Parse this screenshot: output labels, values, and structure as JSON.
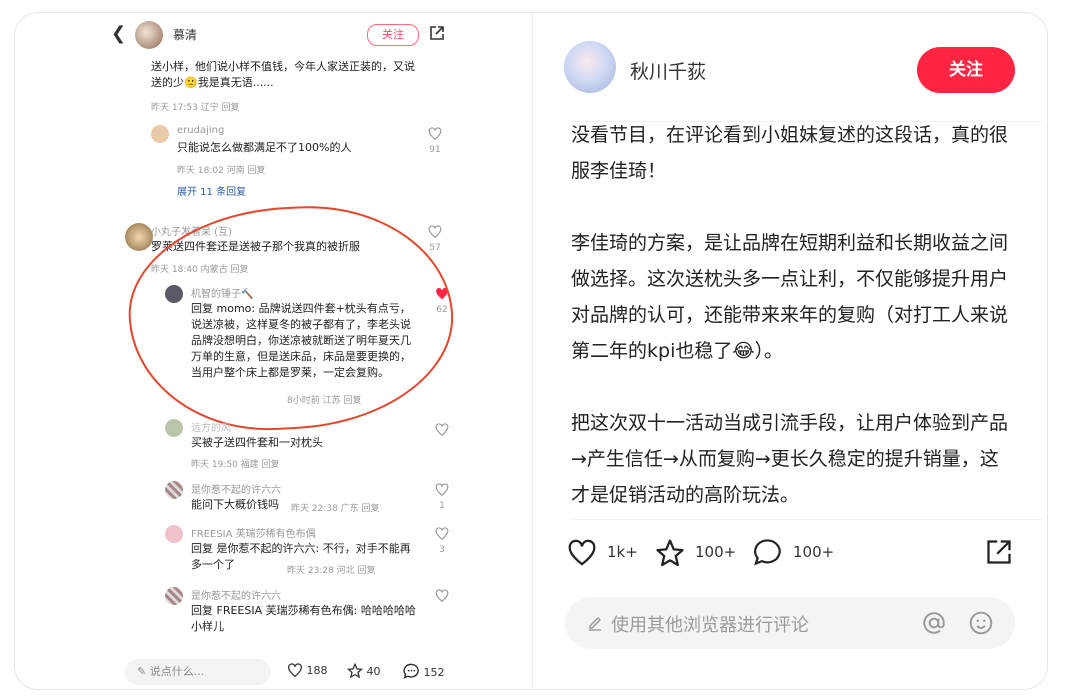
{
  "left_phone": {
    "header": {
      "back_icon": "chevron-left-icon",
      "name": "慕清",
      "follow": "关注",
      "share_icon": "share-icon"
    },
    "comments": [
      {
        "text": "送小样，他们说小样不值钱，今年人家送正装的，又说送的少🙁我是真无语......",
        "meta": "昨天 17:53 辽宁 回复"
      },
      {
        "user": "erudajing",
        "text": "只能说怎么做都满足不了100%的人",
        "meta": "昨天 18:02 河南 回复",
        "likes": "91"
      },
      {
        "expand": "展开 11 条回复"
      },
      {
        "user": "小丸子发着呆 (互)",
        "text": "罗莱送四件套还是送被子那个我真的被折服",
        "meta": "昨天 18:40 内蒙古 回复",
        "likes": "57"
      },
      {
        "user": "机智的锤子🔨",
        "text": "回复 momo: 品牌说送四件套+枕头有点亏，说送凉被，这样夏冬的被子都有了，李老头说品牌没想明白，你送凉被就断送了明年夏天几万单的生意，但是送床品，床品是要更换的，当用户整个床上都是罗莱，一定会复购。",
        "meta": "8小时前 江苏 回复",
        "likes": "62"
      },
      {
        "user": "远方的风",
        "text": "买被子送四件套和一对枕头",
        "meta": "昨天 19:50 福建 回复"
      },
      {
        "user": "是你惹不起的许六六",
        "text": "能问下大概价钱吗",
        "meta": "昨天 22:38 广东 回复",
        "likes": "1"
      },
      {
        "user": "FREESIA 芙瑞莎稀有色布偶",
        "text": "回复 是你惹不起的许六六: 不行，对手不能再多一个了",
        "meta": "昨天 23:28 河北 回复",
        "likes": "3"
      },
      {
        "user": "是你惹不起的许六六",
        "text": "回复 FREESIA 芙瑞莎稀有色布偶: 哈哈哈哈哈小样儿",
        "meta": "昨天 23:29 广东 回复"
      }
    ],
    "bottom": {
      "say": "说点什么...",
      "likes": "188",
      "stars": "40",
      "comments": "152"
    }
  },
  "right_post": {
    "author": "秋川千荻",
    "follow": "关注",
    "paragraphs": [
      "没看节目，在评论看到小姐妹复述的这段话，真的很服李佳琦！",
      "李佳琦的方案，是让品牌在短期利益和长期收益之间做选择。这次送枕头多一点让利，不仅能够提升用户对品牌的认可，还能带来来年的复购（对打工人来说第二年的kpi也稳了😂）。",
      "把这次双十一活动当成引流手段，让用户体验到产品→产生信任→从而复购→更长久稳定的提升销量，这才是促销活动的高阶玩法。"
    ],
    "stats": {
      "likes": "1k+",
      "stars": "100+",
      "comments": "100+"
    },
    "comment_placeholder": "使用其他浏览器进行评论",
    "accent": "#ff2442"
  }
}
